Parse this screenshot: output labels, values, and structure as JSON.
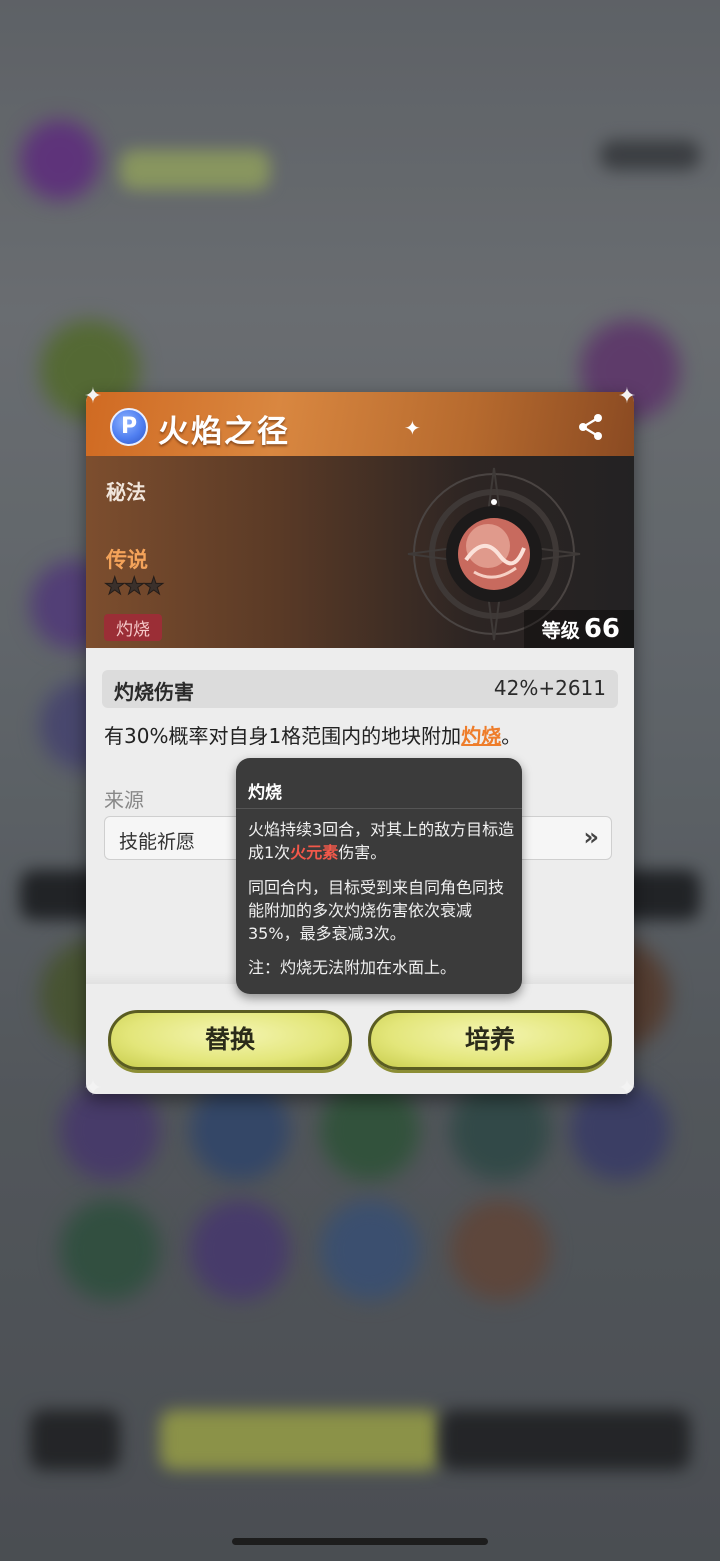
{
  "dialog": {
    "title": "火焰之径",
    "type": "秘法",
    "rarity": "传说",
    "stars_filled": 0,
    "stars_total": 3,
    "element_tag": "灼烧",
    "level_label": "等级",
    "level_value": "66",
    "stat": {
      "name": "灼烧伤害",
      "value": "42%+2611"
    },
    "description": {
      "before": "有30%概率对自身1格范围内的地块附加",
      "keyword": "灼烧",
      "after": "。"
    },
    "source_label": "来源",
    "source_value": "技能祈愿",
    "source_arrow": "»",
    "buttons": {
      "replace": "替换",
      "train": "培养"
    }
  },
  "tooltip": {
    "title": "灼烧",
    "p1_before": "火焰持续3回合，对其上的敌方目标造成1次",
    "p1_highlight": "火元素",
    "p1_after": "伤害。",
    "p2": "同回合内，目标受到来自同角色同技能附加的多次灼烧伤害依次衰减35%，最多衰减3次。",
    "p3": "注：灼烧无法附加在水面上。"
  },
  "colors": {
    "title_bar": "#d06a22",
    "keyword": "#ee7d2b",
    "fire_element": "#f2584a",
    "button_fill": "#e3e67a"
  },
  "icons": {
    "title_icon": "crystal-p-icon",
    "share": "share-icon",
    "emblem": "fire-orb-icon"
  }
}
